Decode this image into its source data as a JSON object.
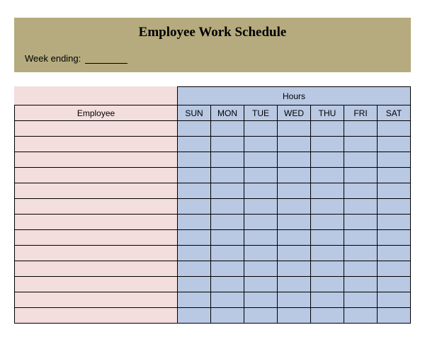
{
  "title": "Employee Work Schedule",
  "week_ending_label": "Week ending:",
  "week_ending_value": "",
  "table": {
    "employee_header": "Employee",
    "hours_header": "Hours",
    "days": [
      "SUN",
      "MON",
      "TUE",
      "WED",
      "THU",
      "FRI",
      "SAT"
    ],
    "rows": [
      {
        "employee": "",
        "hours": [
          "",
          "",
          "",
          "",
          "",
          "",
          ""
        ]
      },
      {
        "employee": "",
        "hours": [
          "",
          "",
          "",
          "",
          "",
          "",
          ""
        ]
      },
      {
        "employee": "",
        "hours": [
          "",
          "",
          "",
          "",
          "",
          "",
          ""
        ]
      },
      {
        "employee": "",
        "hours": [
          "",
          "",
          "",
          "",
          "",
          "",
          ""
        ]
      },
      {
        "employee": "",
        "hours": [
          "",
          "",
          "",
          "",
          "",
          "",
          ""
        ]
      },
      {
        "employee": "",
        "hours": [
          "",
          "",
          "",
          "",
          "",
          "",
          ""
        ]
      },
      {
        "employee": "",
        "hours": [
          "",
          "",
          "",
          "",
          "",
          "",
          ""
        ]
      },
      {
        "employee": "",
        "hours": [
          "",
          "",
          "",
          "",
          "",
          "",
          ""
        ]
      },
      {
        "employee": "",
        "hours": [
          "",
          "",
          "",
          "",
          "",
          "",
          ""
        ]
      },
      {
        "employee": "",
        "hours": [
          "",
          "",
          "",
          "",
          "",
          "",
          ""
        ]
      },
      {
        "employee": "",
        "hours": [
          "",
          "",
          "",
          "",
          "",
          "",
          ""
        ]
      },
      {
        "employee": "",
        "hours": [
          "",
          "",
          "",
          "",
          "",
          "",
          ""
        ]
      },
      {
        "employee": "",
        "hours": [
          "",
          "",
          "",
          "",
          "",
          "",
          ""
        ]
      }
    ]
  }
}
